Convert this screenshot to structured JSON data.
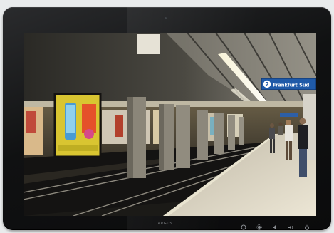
{
  "device": {
    "brand_label": "ARGUS",
    "controls": [
      {
        "icon": "menu-icon"
      },
      {
        "icon": "brightness-icon"
      },
      {
        "icon": "volume-down-icon"
      },
      {
        "icon": "volume-up-icon"
      },
      {
        "icon": "power-icon"
      }
    ]
  },
  "screen": {
    "station_sign": {
      "line_number": "2",
      "destination": "Frankfurt Süd"
    }
  }
}
